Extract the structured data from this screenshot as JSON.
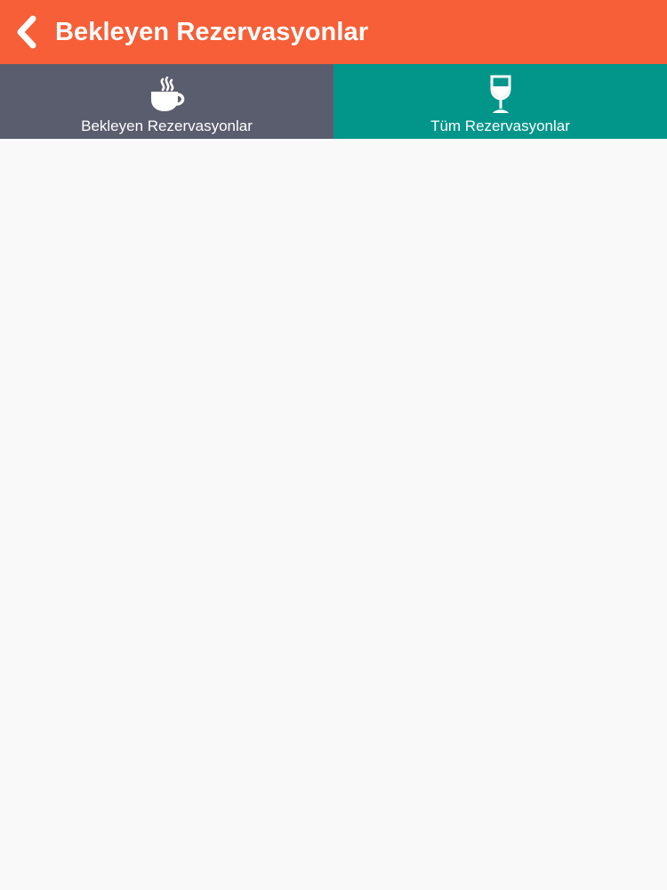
{
  "header": {
    "title": "Bekleyen Rezervasyonlar",
    "back_icon": "chevron-left-icon",
    "background_color": "#f65f38"
  },
  "tabs": [
    {
      "label": "Bekleyen Rezervasyonlar",
      "icon": "coffee-cup-icon",
      "background_color": "#5a5d6e"
    },
    {
      "label": "Tüm Rezervasyonlar",
      "icon": "wine-glass-icon",
      "background_color": "#02958a"
    }
  ],
  "content": {
    "background_color": "#f9f9fa"
  }
}
